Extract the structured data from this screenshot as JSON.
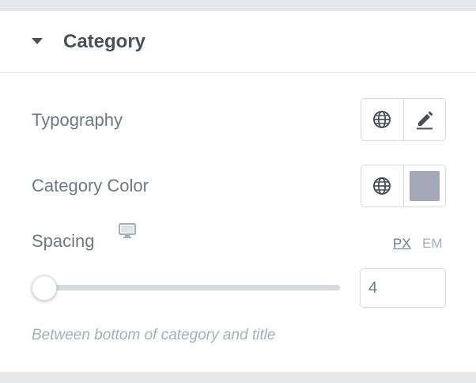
{
  "section": {
    "title": "Category",
    "caret_icon": "caret-down-icon"
  },
  "typography": {
    "label": "Typography",
    "global_icon": "globe-icon",
    "edit_icon": "pencil-icon"
  },
  "category_color": {
    "label": "Category Color",
    "global_icon": "globe-icon",
    "value": "#a4a7b5"
  },
  "spacing": {
    "label": "Spacing",
    "device_icon": "desktop-monitor-icon",
    "units": [
      "PX",
      "EM"
    ],
    "selected_unit": "PX",
    "value": "4",
    "slider_fraction": 0.0,
    "help": "Between bottom of category and title"
  },
  "colors": {
    "panel_bg": "#ffffff",
    "page_bg": "#e6e8ea",
    "text": "#6d7882",
    "heading": "#495157",
    "muted": "#a4afb7",
    "border": "#d5dadf"
  }
}
